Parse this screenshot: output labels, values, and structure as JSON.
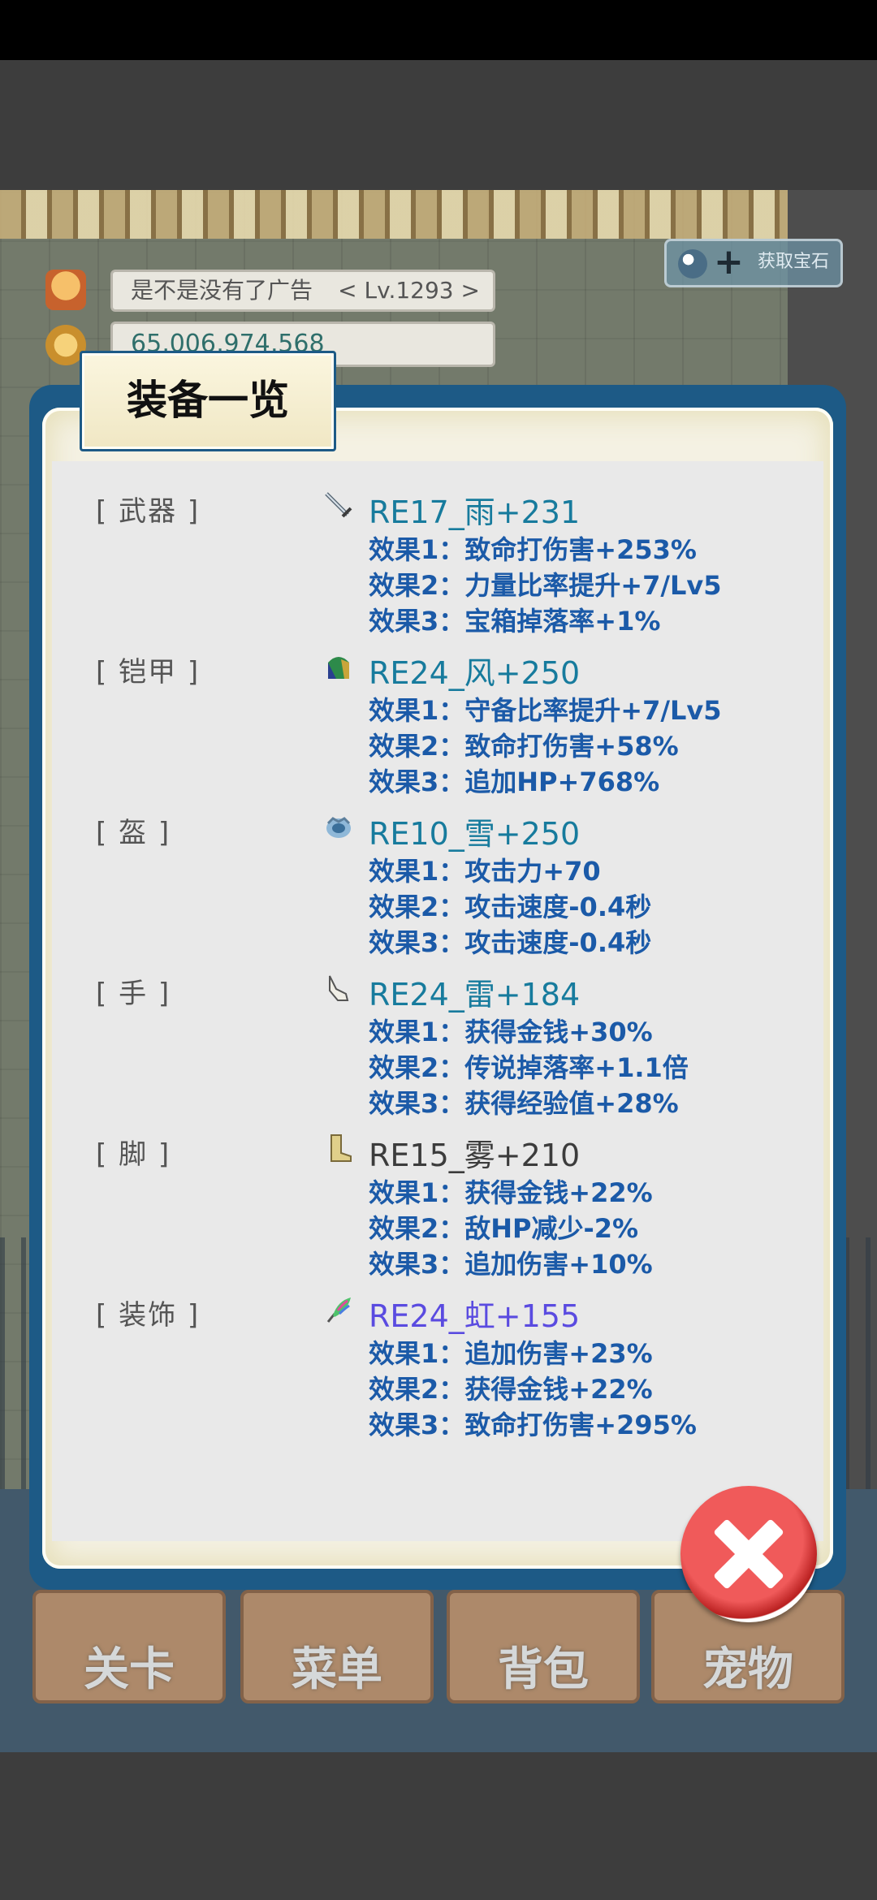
{
  "hud": {
    "player_name": "是不是没有了广告",
    "level": "< Lv.1293 >",
    "gold": "65,006,974,568",
    "get_gem_label": "获取宝石"
  },
  "nav": {
    "stage": "关卡",
    "menu": "菜单",
    "bag": "背包",
    "pet": "宠物"
  },
  "dialog": {
    "title": "装备一览"
  },
  "equipment": [
    {
      "slot": "[ 武器 ]",
      "icon": "sword-icon",
      "name": "RE17_雨+231",
      "name_color": "#177b9d",
      "effects": [
        "效果1：致命打伤害+253%",
        "效果2：力量比率提升+7/Lv5",
        "效果3：宝箱掉落率+1%"
      ]
    },
    {
      "slot": "[ 铠甲 ]",
      "icon": "armor-icon",
      "name": "RE24_风+250",
      "name_color": "#177b9d",
      "effects": [
        "效果1：守备比率提升+7/Lv5",
        "效果2：致命打伤害+58%",
        "效果3：追加HP+768%"
      ]
    },
    {
      "slot": "[ 盔 ]",
      "icon": "helmet-icon",
      "name": "RE10_雪+250",
      "name_color": "#177b9d",
      "effects": [
        "效果1：攻击力+70",
        "效果2：攻击速度-0.4秒",
        "效果3：攻击速度-0.4秒"
      ]
    },
    {
      "slot": "[ 手 ]",
      "icon": "glove-icon",
      "name": "RE24_雷+184",
      "name_color": "#177b9d",
      "effects": [
        "效果1：获得金钱+30%",
        "效果2：传说掉落率+1.1倍",
        "效果3：获得经验值+28%"
      ]
    },
    {
      "slot": "[ 脚 ]",
      "icon": "boot-icon",
      "name": "RE15_雾+210",
      "name_color": "#3c3c3c",
      "effects": [
        "效果1：获得金钱+22%",
        "效果2：敌HP减少-2%",
        "效果3：追加伤害+10%"
      ]
    },
    {
      "slot": "[ 装饰 ]",
      "icon": "feather-accessory-icon",
      "name": "RE24_虹+155",
      "name_color": "#5a4be0",
      "effects": [
        "效果1：追加伤害+23%",
        "效果2：获得金钱+22%",
        "效果3：致命打伤害+295%"
      ]
    }
  ],
  "close": {
    "icon": "close-icon"
  }
}
